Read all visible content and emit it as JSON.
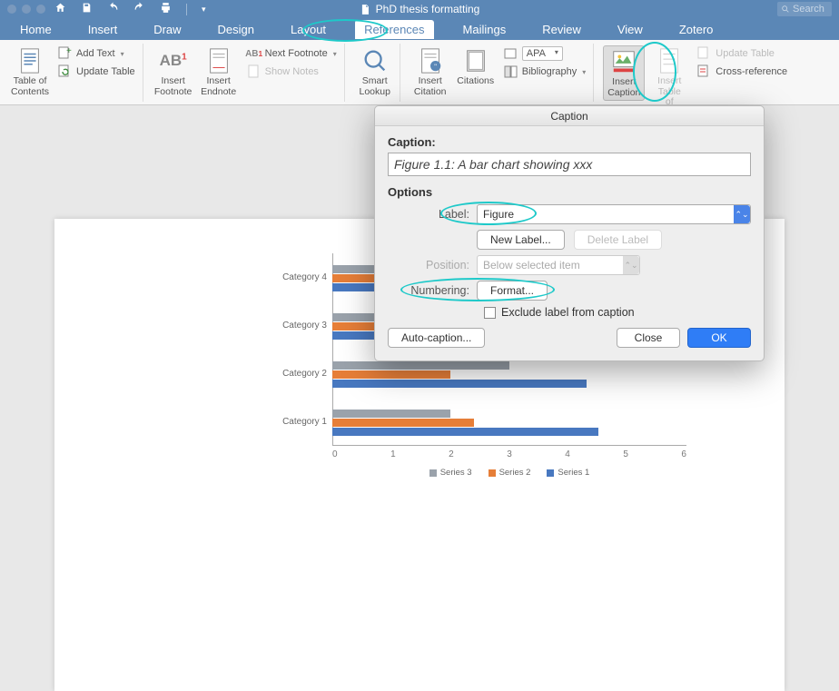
{
  "window": {
    "title": "PhD thesis formatting",
    "search_placeholder": "Search"
  },
  "tabs": [
    "Home",
    "Insert",
    "Draw",
    "Design",
    "Layout",
    "References",
    "Mailings",
    "Review",
    "View",
    "Zotero"
  ],
  "active_tab": "References",
  "ribbon": {
    "toc": "Table of\nContents",
    "add_text": "Add Text",
    "update_table1": "Update Table",
    "insert_footnote": "Insert\nFootnote",
    "insert_endnote": "Insert\nEndnote",
    "next_footnote": "Next Footnote",
    "show_notes": "Show Notes",
    "smart_lookup": "Smart\nLookup",
    "insert_citation": "Insert\nCitation",
    "citations": "Citations",
    "style_label": "APA",
    "bibliography": "Bibliography",
    "insert_caption": "Insert\nCaption",
    "insert_tof": "Insert Table\nof Figures",
    "update_table2": "Update Table",
    "cross_ref": "Cross-reference",
    "ab_badge": "AB",
    "ab_next_badge": "AB"
  },
  "dialog": {
    "title": "Caption",
    "caption_label": "Caption:",
    "caption_value": "Figure 1.1: A bar chart showing xxx",
    "options_label": "Options",
    "label_label": "Label:",
    "label_value": "Figure",
    "new_label_btn": "New Label...",
    "delete_label_btn": "Delete Label",
    "position_label": "Position:",
    "position_value": "Below selected item",
    "numbering_label": "Numbering:",
    "format_btn": "Format...",
    "exclude_label": "Exclude label from caption",
    "auto_caption_btn": "Auto-caption...",
    "close_btn": "Close",
    "ok_btn": "OK"
  },
  "chart_data": {
    "type": "bar",
    "orientation": "horizontal",
    "categories": [
      "Category 1",
      "Category 2",
      "Category 3",
      "Category 4"
    ],
    "series": [
      {
        "name": "Series 3",
        "color": "#9aa2ab",
        "values": [
          2.0,
          3.0,
          1.8,
          2.0
        ]
      },
      {
        "name": "Series 2",
        "color": "#e67e38",
        "values": [
          2.4,
          2.0,
          2.0,
          2.8
        ]
      },
      {
        "name": "Series 1",
        "color": "#4878c0",
        "values": [
          4.5,
          4.3,
          3.5,
          2.5
        ]
      }
    ],
    "xlabel": "",
    "ylabel": "",
    "xticks": [
      0,
      1,
      2,
      3,
      4,
      5,
      6
    ],
    "xlim": [
      0,
      6
    ]
  }
}
